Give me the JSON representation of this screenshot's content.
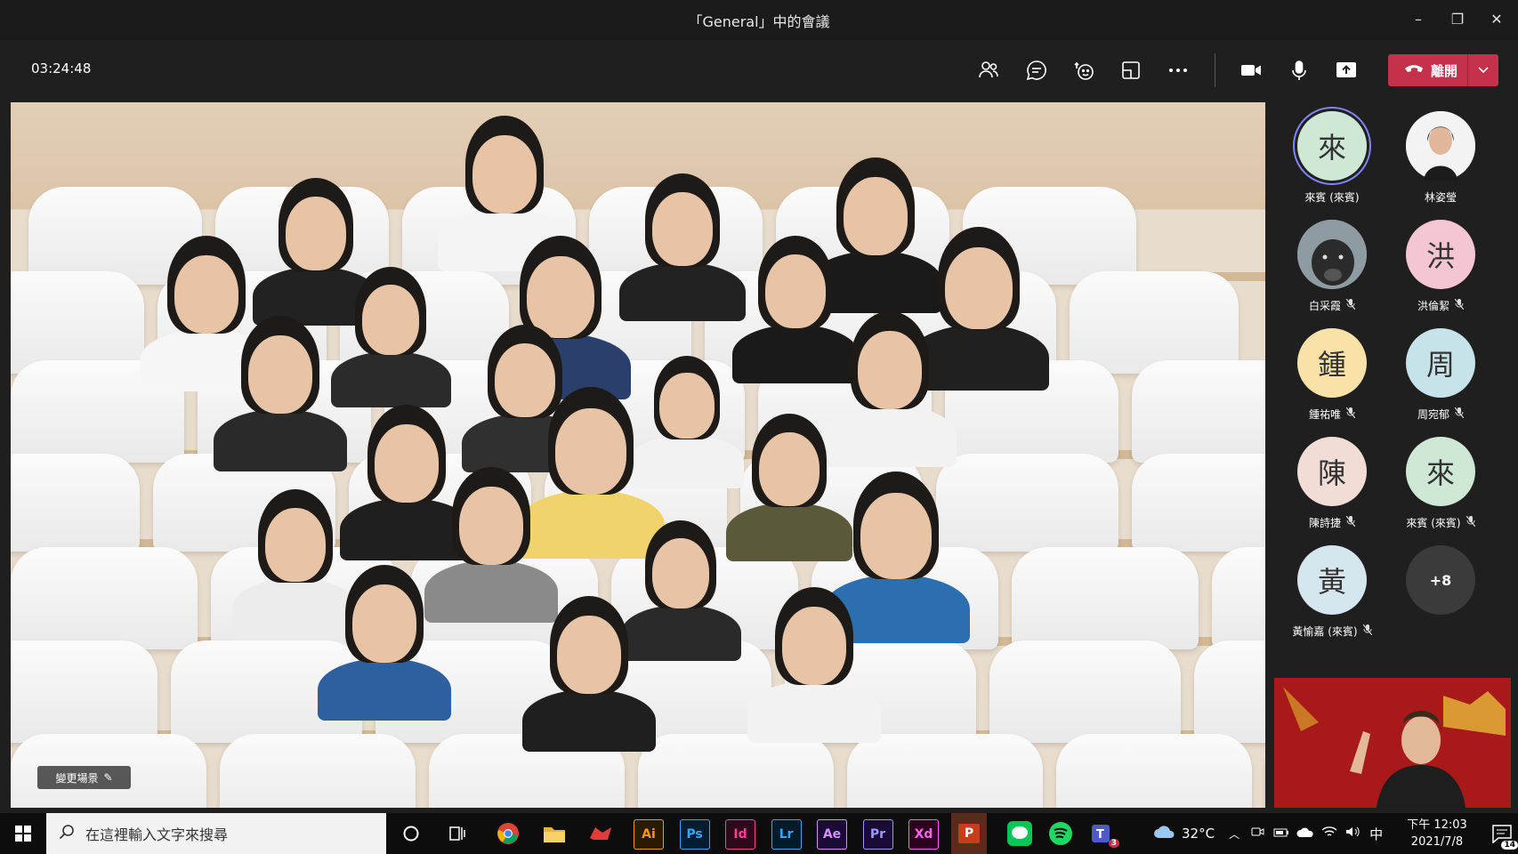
{
  "window": {
    "title": "「General」中的會議",
    "controls": {
      "minimize": "–",
      "restore": "❐",
      "close": "✕"
    }
  },
  "toolbar": {
    "timer": "03:24:48",
    "icons": [
      "people-icon",
      "chat-icon",
      "reactions-icon",
      "room-icon",
      "more-options-icon",
      "camera-icon",
      "microphone-icon",
      "share-screen-icon"
    ],
    "leave_label": "離開",
    "leave_color": "#c4314b"
  },
  "stage": {
    "change_background_label": "變更場景"
  },
  "participants": [
    {
      "initial": "來",
      "name": "來賓 (來賓)",
      "color": "#cfe8d5",
      "muted": false,
      "speaking": true
    },
    {
      "initial": "",
      "name": "林姿瑩",
      "color": "#f2f2f2",
      "muted": false,
      "photo": true
    },
    {
      "initial": "",
      "name": "白采霞",
      "color": "#7b8a8f",
      "muted": true,
      "photo": true
    },
    {
      "initial": "洪",
      "name": "洪倫絜",
      "color": "#f4c6d4",
      "muted": true
    },
    {
      "initial": "鍾",
      "name": "鍾祐唯",
      "color": "#f8e2a8",
      "muted": true
    },
    {
      "initial": "周",
      "name": "周宛郁",
      "color": "#c7e3ea",
      "muted": true
    },
    {
      "initial": "陳",
      "name": "陳詩捷",
      "color": "#f1dcd6",
      "muted": true
    },
    {
      "initial": "來",
      "name": "來賓 (來賓)",
      "color": "#cfe8d5",
      "muted": true
    },
    {
      "initial": "黃",
      "name": "黃愉嘉 (來賓)",
      "color": "#d5e6ee",
      "muted": true
    }
  ],
  "overflow": {
    "label": "+8"
  },
  "taskbar": {
    "search_placeholder": "在這裡輸入文字來搜尋",
    "apps": [
      {
        "label": "Ai",
        "color": "#2b1a00",
        "fg": "#ff9a00",
        "name": "illustrator-icon"
      },
      {
        "label": "Ps",
        "color": "#001d34",
        "fg": "#31a8ff",
        "name": "photoshop-icon"
      },
      {
        "label": "Id",
        "color": "#2c0a1c",
        "fg": "#ff3f94",
        "name": "indesign-icon"
      },
      {
        "label": "Lr",
        "color": "#001b2b",
        "fg": "#31a8ff",
        "name": "lightroom-icon"
      },
      {
        "label": "Ae",
        "color": "#1a0b36",
        "fg": "#d291ff",
        "name": "after-effects-icon"
      },
      {
        "label": "Pr",
        "color": "#1a0b36",
        "fg": "#9999ff",
        "name": "premiere-icon"
      },
      {
        "label": "Xd",
        "color": "#2e001f",
        "fg": "#ff61f6",
        "name": "xd-icon"
      },
      {
        "label": "P",
        "color": "#c43e1c",
        "fg": "#ffffff",
        "name": "powerpoint-icon"
      }
    ],
    "teams_badge": "3",
    "weather": "32°C",
    "ime": "中",
    "time": "下午 12:03",
    "date": "2021/7/8",
    "notifications": "14"
  }
}
